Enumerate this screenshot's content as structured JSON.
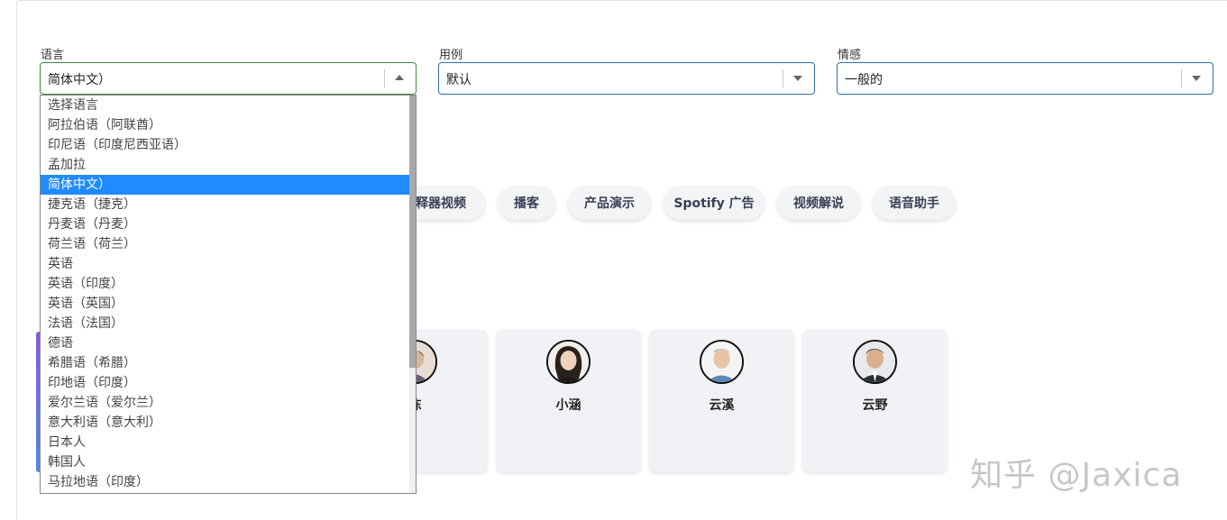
{
  "filters": {
    "language": {
      "label": "语言",
      "value": "简体中文）"
    },
    "use_case": {
      "label": "用例",
      "value": "默认"
    },
    "emotion": {
      "label": "情感",
      "value": "一般的"
    }
  },
  "language_options": [
    "选择语言",
    "阿拉伯语（阿联酋）",
    "印尼语（印度尼西亚语）",
    "孟加拉",
    "简体中文）",
    "捷克语（捷克）",
    "丹麦语（丹麦）",
    "荷兰语（荷兰）",
    "英语",
    "英语（印度）",
    "英语（英国）",
    "法语（法国）",
    "德语",
    "希腊语（希腊）",
    "印地语（印度）",
    "爱尔兰语（爱尔兰）",
    "意大利语（意大利）",
    "日本人",
    "韩国人",
    "马拉地语（印度）"
  ],
  "selected_language_index": 4,
  "use_case_chips": [
    "释器视频",
    "播客",
    "产品演示",
    "Spotify 广告",
    "视频解说",
    "语音助手"
  ],
  "voices": [
    {
      "name": "陈"
    },
    {
      "name": "小涵"
    },
    {
      "name": "云溪"
    },
    {
      "name": "云野"
    }
  ],
  "watermark": "知乎 @Jaxica"
}
